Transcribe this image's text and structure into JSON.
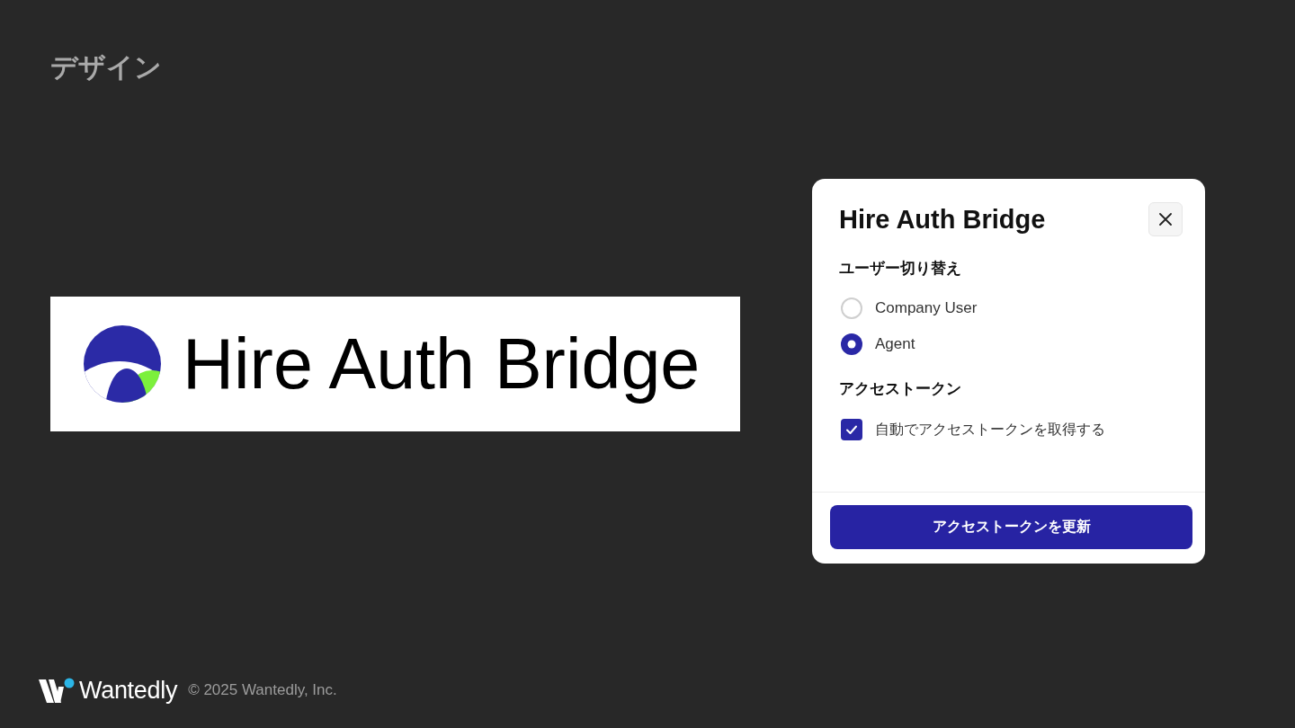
{
  "slide": {
    "title": "デザイン"
  },
  "logo_banner": {
    "wordmark": "Hire Auth Bridge"
  },
  "panel": {
    "title": "Hire Auth Bridge",
    "sections": [
      {
        "heading": "ユーザー切り替え",
        "kind": "radio",
        "options": [
          {
            "label": "Company User",
            "selected": false
          },
          {
            "label": "Agent",
            "selected": true
          }
        ]
      },
      {
        "heading": "アクセストークン",
        "kind": "checkbox",
        "options": [
          {
            "label": "自動でアクセストークンを取得する",
            "checked": true
          }
        ]
      }
    ],
    "action_button": "アクセストークンを更新"
  },
  "footer": {
    "brand": "Wantedly",
    "copyright": "© 2025 Wantedly, Inc."
  }
}
